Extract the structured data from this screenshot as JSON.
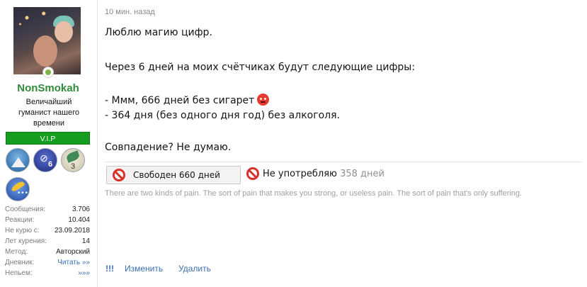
{
  "user": {
    "name": "NonSmokah",
    "title": "Величайший гуманист нашего времени",
    "badge": "V.I.P",
    "trophy_count_2": "6",
    "trophy_count_3": "3",
    "stats": [
      {
        "key": "Сообщения:",
        "value": "3.706"
      },
      {
        "key": "Реакции:",
        "value": "10.404"
      },
      {
        "key": "Не курю с:",
        "value": "23.09.2018"
      },
      {
        "key": "Лет курения:",
        "value": "14"
      },
      {
        "key": "Метод:",
        "value": "Авторский"
      },
      {
        "key": "Дневник:",
        "value": "Читать »»"
      },
      {
        "key": "Непьем:",
        "value": "»»»"
      }
    ]
  },
  "post": {
    "timestamp": "10 мин. назад",
    "lines": [
      "Люблю магию цифр.",
      "Через 6 дней на моих счётчиках будут следующие цифры:",
      "- Ммм, 666 дней без сигарет",
      "- 364 дня (без одного дня год) без алкоголя.",
      "Совпадение? Не думаю."
    ],
    "emoji_icon": "devil-emoji-icon"
  },
  "signature": {
    "counter1": "Свободен 660 дней",
    "counter2_prefix": "Не употребляю",
    "counter2_value": "358 дней",
    "quote": "There are two kinds of pain. The sort of pain that makes you strong, or useless pain. The sort of pain that's only suffering."
  },
  "actions": {
    "more": "!!!",
    "edit": "Изменить",
    "delete": "Удалить"
  }
}
